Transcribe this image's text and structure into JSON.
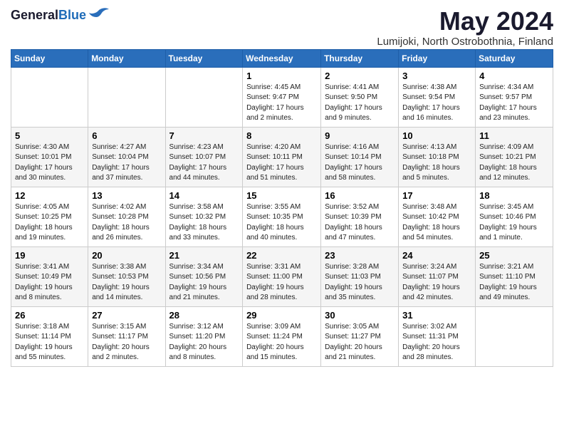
{
  "header": {
    "logo_general": "General",
    "logo_blue": "Blue",
    "title": "May 2024",
    "subtitle": "Lumijoki, North Ostrobothnia, Finland"
  },
  "weekdays": [
    "Sunday",
    "Monday",
    "Tuesday",
    "Wednesday",
    "Thursday",
    "Friday",
    "Saturday"
  ],
  "weeks": [
    [
      {
        "day": "",
        "info": ""
      },
      {
        "day": "",
        "info": ""
      },
      {
        "day": "",
        "info": ""
      },
      {
        "day": "1",
        "info": "Sunrise: 4:45 AM\nSunset: 9:47 PM\nDaylight: 17 hours\nand 2 minutes."
      },
      {
        "day": "2",
        "info": "Sunrise: 4:41 AM\nSunset: 9:50 PM\nDaylight: 17 hours\nand 9 minutes."
      },
      {
        "day": "3",
        "info": "Sunrise: 4:38 AM\nSunset: 9:54 PM\nDaylight: 17 hours\nand 16 minutes."
      },
      {
        "day": "4",
        "info": "Sunrise: 4:34 AM\nSunset: 9:57 PM\nDaylight: 17 hours\nand 23 minutes."
      }
    ],
    [
      {
        "day": "5",
        "info": "Sunrise: 4:30 AM\nSunset: 10:01 PM\nDaylight: 17 hours\nand 30 minutes."
      },
      {
        "day": "6",
        "info": "Sunrise: 4:27 AM\nSunset: 10:04 PM\nDaylight: 17 hours\nand 37 minutes."
      },
      {
        "day": "7",
        "info": "Sunrise: 4:23 AM\nSunset: 10:07 PM\nDaylight: 17 hours\nand 44 minutes."
      },
      {
        "day": "8",
        "info": "Sunrise: 4:20 AM\nSunset: 10:11 PM\nDaylight: 17 hours\nand 51 minutes."
      },
      {
        "day": "9",
        "info": "Sunrise: 4:16 AM\nSunset: 10:14 PM\nDaylight: 17 hours\nand 58 minutes."
      },
      {
        "day": "10",
        "info": "Sunrise: 4:13 AM\nSunset: 10:18 PM\nDaylight: 18 hours\nand 5 minutes."
      },
      {
        "day": "11",
        "info": "Sunrise: 4:09 AM\nSunset: 10:21 PM\nDaylight: 18 hours\nand 12 minutes."
      }
    ],
    [
      {
        "day": "12",
        "info": "Sunrise: 4:05 AM\nSunset: 10:25 PM\nDaylight: 18 hours\nand 19 minutes."
      },
      {
        "day": "13",
        "info": "Sunrise: 4:02 AM\nSunset: 10:28 PM\nDaylight: 18 hours\nand 26 minutes."
      },
      {
        "day": "14",
        "info": "Sunrise: 3:58 AM\nSunset: 10:32 PM\nDaylight: 18 hours\nand 33 minutes."
      },
      {
        "day": "15",
        "info": "Sunrise: 3:55 AM\nSunset: 10:35 PM\nDaylight: 18 hours\nand 40 minutes."
      },
      {
        "day": "16",
        "info": "Sunrise: 3:52 AM\nSunset: 10:39 PM\nDaylight: 18 hours\nand 47 minutes."
      },
      {
        "day": "17",
        "info": "Sunrise: 3:48 AM\nSunset: 10:42 PM\nDaylight: 18 hours\nand 54 minutes."
      },
      {
        "day": "18",
        "info": "Sunrise: 3:45 AM\nSunset: 10:46 PM\nDaylight: 19 hours\nand 1 minute."
      }
    ],
    [
      {
        "day": "19",
        "info": "Sunrise: 3:41 AM\nSunset: 10:49 PM\nDaylight: 19 hours\nand 8 minutes."
      },
      {
        "day": "20",
        "info": "Sunrise: 3:38 AM\nSunset: 10:53 PM\nDaylight: 19 hours\nand 14 minutes."
      },
      {
        "day": "21",
        "info": "Sunrise: 3:34 AM\nSunset: 10:56 PM\nDaylight: 19 hours\nand 21 minutes."
      },
      {
        "day": "22",
        "info": "Sunrise: 3:31 AM\nSunset: 11:00 PM\nDaylight: 19 hours\nand 28 minutes."
      },
      {
        "day": "23",
        "info": "Sunrise: 3:28 AM\nSunset: 11:03 PM\nDaylight: 19 hours\nand 35 minutes."
      },
      {
        "day": "24",
        "info": "Sunrise: 3:24 AM\nSunset: 11:07 PM\nDaylight: 19 hours\nand 42 minutes."
      },
      {
        "day": "25",
        "info": "Sunrise: 3:21 AM\nSunset: 11:10 PM\nDaylight: 19 hours\nand 49 minutes."
      }
    ],
    [
      {
        "day": "26",
        "info": "Sunrise: 3:18 AM\nSunset: 11:14 PM\nDaylight: 19 hours\nand 55 minutes."
      },
      {
        "day": "27",
        "info": "Sunrise: 3:15 AM\nSunset: 11:17 PM\nDaylight: 20 hours\nand 2 minutes."
      },
      {
        "day": "28",
        "info": "Sunrise: 3:12 AM\nSunset: 11:20 PM\nDaylight: 20 hours\nand 8 minutes."
      },
      {
        "day": "29",
        "info": "Sunrise: 3:09 AM\nSunset: 11:24 PM\nDaylight: 20 hours\nand 15 minutes."
      },
      {
        "day": "30",
        "info": "Sunrise: 3:05 AM\nSunset: 11:27 PM\nDaylight: 20 hours\nand 21 minutes."
      },
      {
        "day": "31",
        "info": "Sunrise: 3:02 AM\nSunset: 11:31 PM\nDaylight: 20 hours\nand 28 minutes."
      },
      {
        "day": "",
        "info": ""
      }
    ]
  ]
}
